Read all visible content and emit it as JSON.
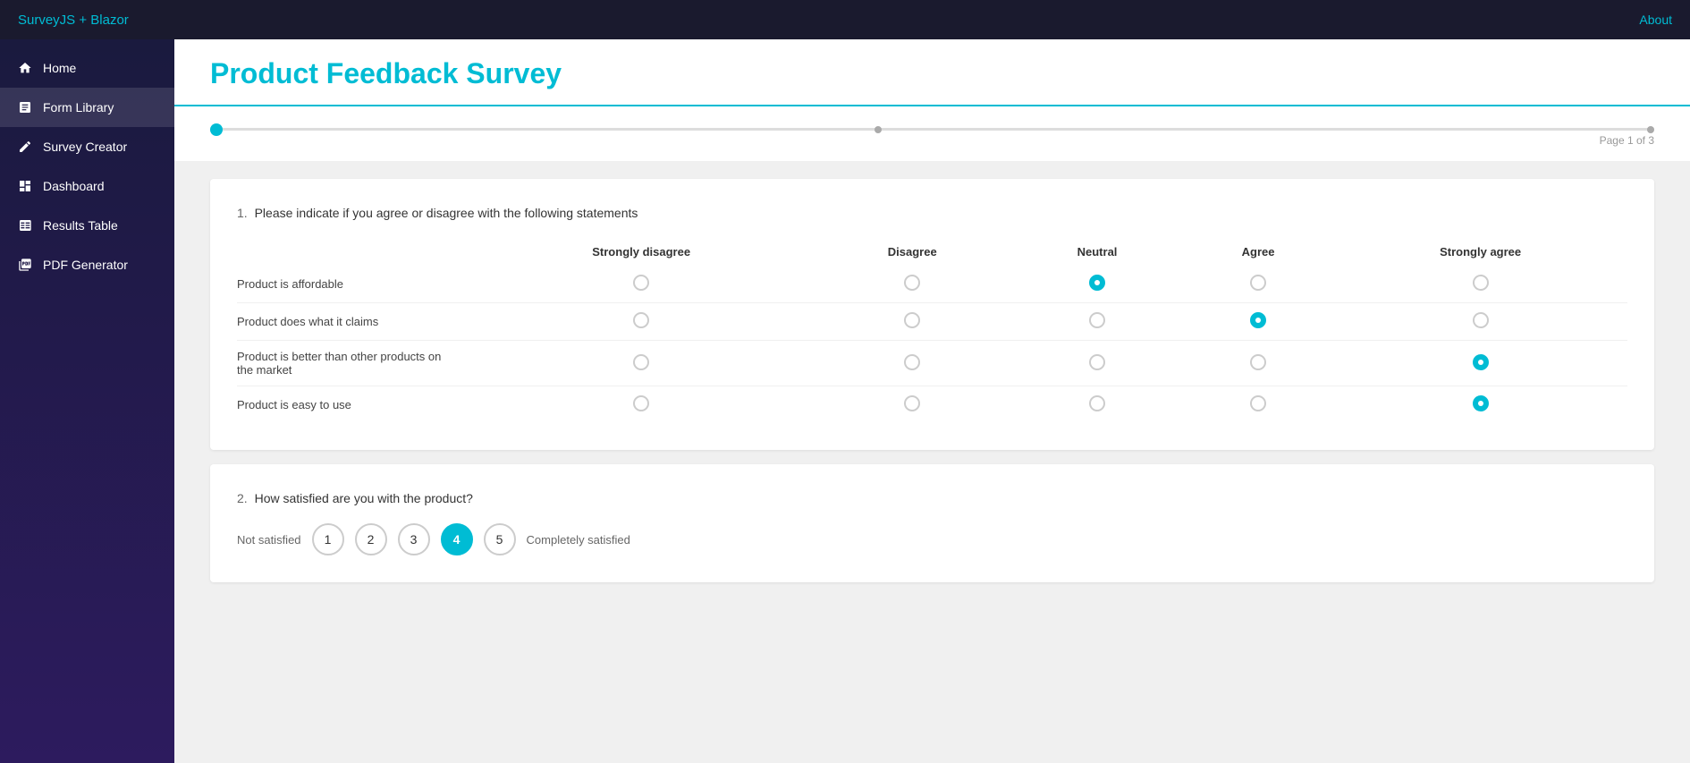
{
  "topbar": {
    "brand": "SurveyJS + Blazor",
    "about": "About"
  },
  "sidebar": {
    "items": [
      {
        "id": "home",
        "label": "Home",
        "icon": "home-icon"
      },
      {
        "id": "form-library",
        "label": "Form Library",
        "icon": "form-icon",
        "active": true
      },
      {
        "id": "survey-creator",
        "label": "Survey Creator",
        "icon": "survey-icon"
      },
      {
        "id": "dashboard",
        "label": "Dashboard",
        "icon": "dashboard-icon"
      },
      {
        "id": "results-table",
        "label": "Results Table",
        "icon": "table-icon"
      },
      {
        "id": "pdf-generator",
        "label": "PDF Generator",
        "icon": "pdf-icon"
      }
    ]
  },
  "survey": {
    "title": "Product Feedback Survey",
    "page_indicator": "Page 1 of 3",
    "questions": [
      {
        "num": "1.",
        "text": "Please indicate if you agree or disagree with the following statements",
        "type": "matrix",
        "columns": [
          "Strongly disagree",
          "Disagree",
          "Neutral",
          "Agree",
          "Strongly agree"
        ],
        "rows": [
          {
            "text": "Product is affordable",
            "selected": 2
          },
          {
            "text": "Product does what it claims",
            "selected": 3
          },
          {
            "text": "Product is better than other products on the market",
            "selected": 4
          },
          {
            "text": "Product is easy to use",
            "selected": 4
          }
        ]
      },
      {
        "num": "2.",
        "text": "How satisfied are you with the product?",
        "type": "rating",
        "labels": {
          "start": "Not satisfied",
          "end": "Completely satisfied"
        },
        "options": [
          "1",
          "2",
          "3",
          "4",
          "5"
        ],
        "selected": "4"
      }
    ]
  }
}
